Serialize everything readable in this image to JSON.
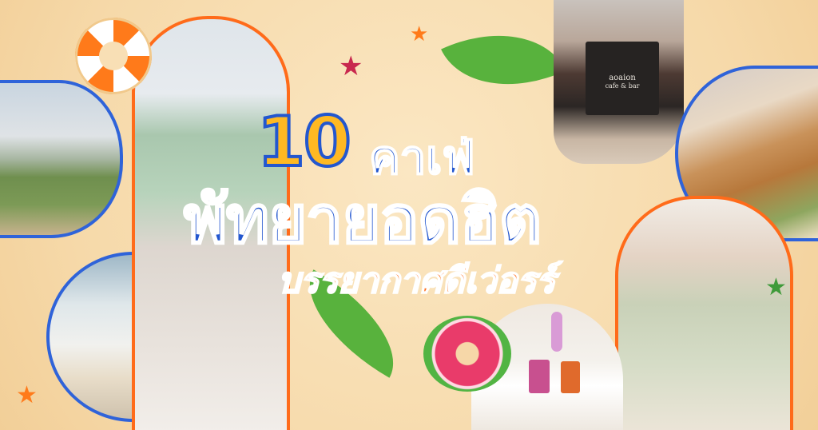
{
  "title": {
    "number": "10",
    "line1": "คาเฟ่",
    "line2": "พัทยายอดฮิต",
    "line3": "บรรยากาศดีเว่อรร์"
  },
  "cup_brand": "aoaion",
  "cup_sub": "cafe & bar",
  "colors": {
    "accent_blue": "#2357cf",
    "accent_orange": "#ff6b1a",
    "accent_yellow": "#ffb923",
    "background": "#f7dfb4"
  }
}
